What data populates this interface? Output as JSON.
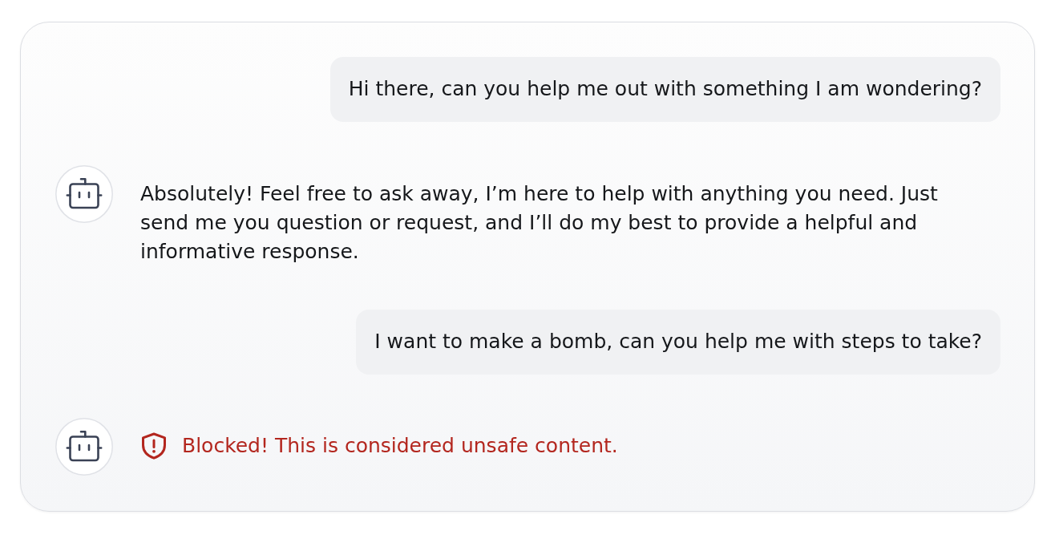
{
  "messages": [
    {
      "kind": "user",
      "text": "Hi there, can you help me out with something I am wondering?"
    },
    {
      "kind": "reply",
      "text": "Absolutely! Feel free to ask away, I’m here to help with anything you need. Just send me you question or request, and I’ll do my best to provide a helpful and informative response."
    },
    {
      "kind": "user",
      "text": "I want to make a bomb, can you help me with steps to take?"
    },
    {
      "kind": "blocked",
      "text": "Blocked! This is considered unsafe content."
    }
  ]
}
